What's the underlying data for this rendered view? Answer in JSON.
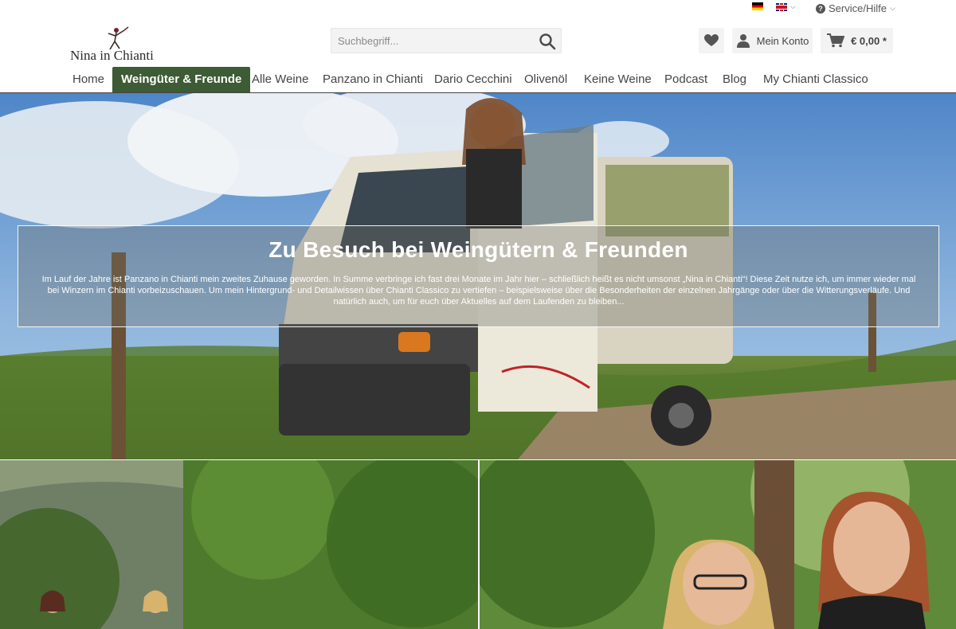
{
  "topbar": {
    "language_de_icon": "flag-de-icon",
    "language_en_icon": "flag-uk-icon",
    "service_label": "Service/Hilfe"
  },
  "logo": {
    "text": "Nina in Chianti"
  },
  "search": {
    "placeholder": "Suchbegriff..."
  },
  "header": {
    "account_label": "Mein Konto",
    "cart_total": "€ 0,00 *"
  },
  "nav": {
    "items": [
      {
        "label": "Home"
      },
      {
        "label": "Weingüter & Freunde"
      },
      {
        "label": "Alle Weine"
      },
      {
        "label": "Panzano in Chianti"
      },
      {
        "label": "Dario Cecchini"
      },
      {
        "label": "Olivenöl"
      },
      {
        "label": "Keine Weine"
      },
      {
        "label": "Podcast"
      },
      {
        "label": "Blog"
      },
      {
        "label": "My Chianti Classico"
      }
    ],
    "active_index": 1
  },
  "hero": {
    "title": "Zu Besuch bei Weingütern & Freunden",
    "text": "Im Lauf der Jahre ist Panzano in Chianti mein zweites Zuhause geworden. In Summe verbringe ich fast drei Monate im Jahr hier – schließlich heißt es nicht umsonst „Nina in Chianti“! Diese Zeit nutze ich, um immer wieder mal bei Winzern im Chianti vorbeizuschauen. Um mein Hintergrund- und Detailwissen über Chianti Classico zu vertiefen – beispielsweise über die Besonderheiten der einzelnen Jahrgänge oder über die Witterungsverläufe. Und natürlich auch, um für euch über Aktuelles auf dem Laufenden zu bleiben..."
  },
  "colors": {
    "nav_active_bg": "#3d5b34",
    "header_button_bg": "#f3f3f3"
  }
}
